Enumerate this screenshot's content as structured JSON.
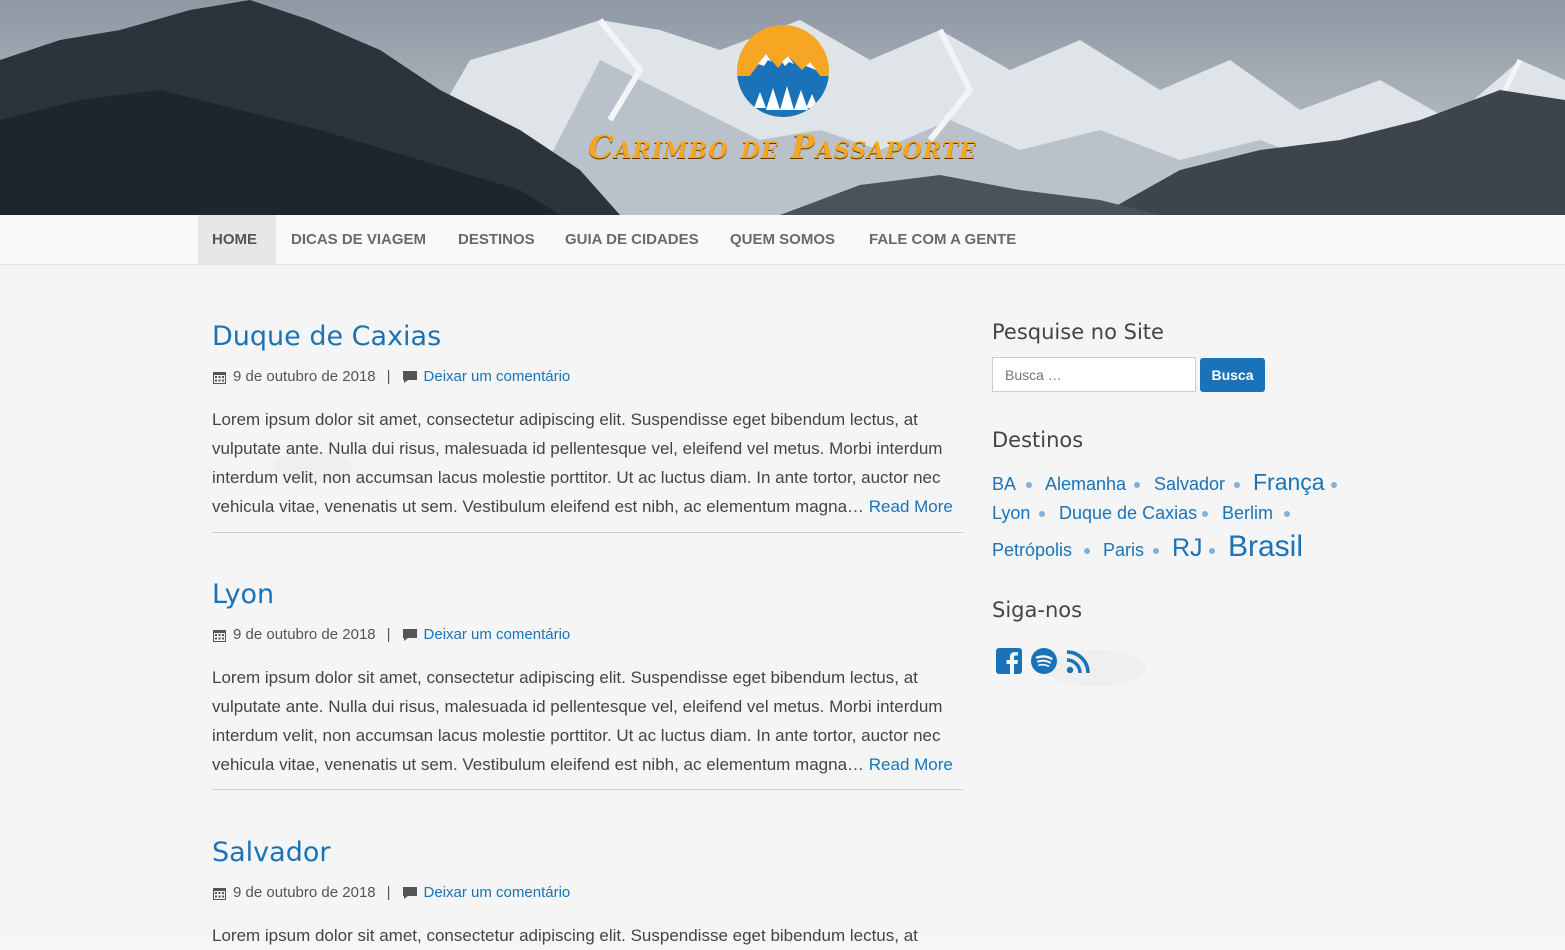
{
  "site": {
    "title": "Carimbo de Passaporte",
    "accent_color": "#1a73b8",
    "title_color": "#f6a623"
  },
  "nav": {
    "items": [
      {
        "label": "HOME",
        "active": true
      },
      {
        "label": "DICAS DE VIAGEM"
      },
      {
        "label": "DESTINOS"
      },
      {
        "label": "GUIA DE CIDADES"
      },
      {
        "label": "QUEM SOMOS"
      },
      {
        "label": "FALE COM A GENTE"
      }
    ]
  },
  "posts": [
    {
      "title": "Duque de Caxias",
      "date": "9 de outubro de 2018",
      "separator": "|",
      "comment_link": "Deixar um comentário",
      "excerpt": "Lorem ipsum dolor sit amet, consectetur adipiscing elit. Suspendisse eget bibendum lectus, at vulputate ante. Nulla dui risus, malesuada id pellentesque vel, eleifend vel metus. Morbi interdum interdum velit, non accumsan lacus molestie porttitor. Ut ac luctus diam. In ante tortor, auctor nec vehicula vitae, venenatis ut sem. Vestibulum eleifend est nibh, ac elementum magna…",
      "read_more": "Read More"
    },
    {
      "title": "Lyon",
      "date": "9 de outubro de 2018",
      "separator": "|",
      "comment_link": "Deixar um comentário",
      "excerpt": "Lorem ipsum dolor sit amet, consectetur adipiscing elit. Suspendisse eget bibendum lectus, at vulputate ante. Nulla dui risus, malesuada id pellentesque vel, eleifend vel metus. Morbi interdum interdum velit, non accumsan lacus molestie porttitor. Ut ac luctus diam. In ante tortor, auctor nec vehicula vitae, venenatis ut sem. Vestibulum eleifend est nibh, ac elementum magna…",
      "read_more": "Read More"
    },
    {
      "title": "Salvador",
      "date": "9 de outubro de 2018",
      "separator": "|",
      "comment_link": "Deixar um comentário",
      "excerpt": "Lorem ipsum dolor sit amet, consectetur adipiscing elit. Suspendisse eget bibendum lectus, at"
    }
  ],
  "sidebar": {
    "search_title": "Pesquise no Site",
    "search_placeholder": "Busca …",
    "search_button": "Busca",
    "tags_title": "Destinos",
    "tags": [
      "BA",
      "Alemanha",
      "Salvador",
      "França",
      "Lyon",
      "Duque de Caxias",
      "Berlim",
      "Petrópolis",
      "Paris",
      "RJ",
      "Brasil"
    ],
    "social_title": "Siga-nos",
    "social_icons": [
      "facebook-icon",
      "spotify-icon",
      "rss-icon"
    ]
  }
}
